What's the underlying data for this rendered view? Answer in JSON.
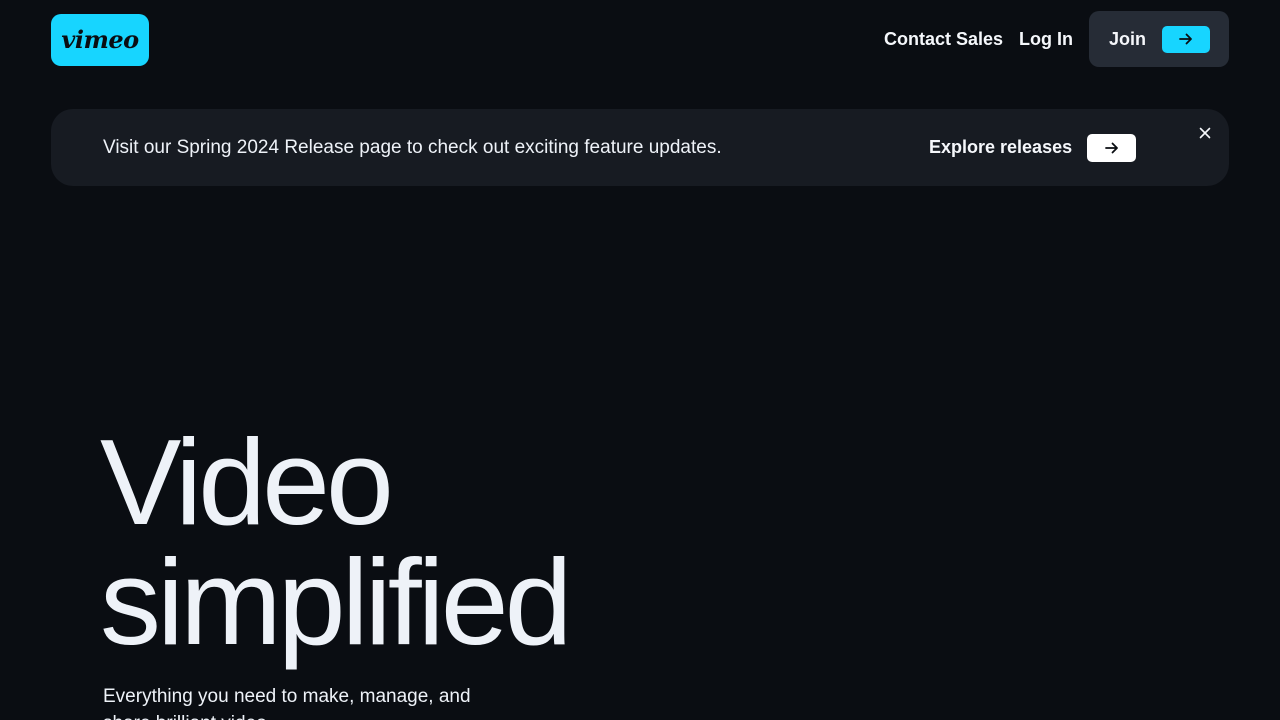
{
  "header": {
    "logo_text": "vimeo",
    "nav": {
      "contact_sales": "Contact Sales",
      "log_in": "Log In",
      "join": "Join"
    }
  },
  "banner": {
    "message": "Visit our Spring 2024 Release page to check out exciting feature updates.",
    "cta_label": "Explore releases"
  },
  "hero": {
    "title_line1": "Video",
    "title_line2": "simplified",
    "subtitle": "Everything you need to make, manage, and share brilliant video."
  },
  "colors": {
    "background": "#0a0d12",
    "accent": "#17d5ff",
    "banner_bg": "#171b22",
    "join_bg": "#262c36"
  },
  "icons": {
    "join_arrow": "arrow-right-icon",
    "banner_arrow": "arrow-right-icon",
    "banner_close": "close-icon"
  }
}
